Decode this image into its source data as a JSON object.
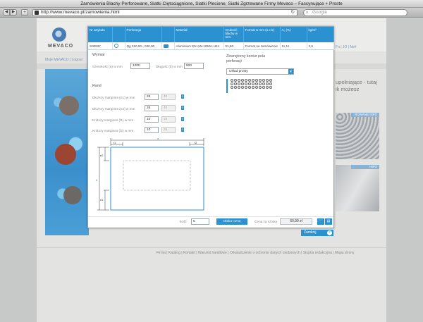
{
  "browser": {
    "window_title": "Zamówienia Blachy Perforowane, Siatki Cięto­ciągnione, Siatki Plecione, Siatki Zgrzewane Firmy Mevaco – Fascynujące + Proste",
    "url": "http://www.mevaco.pl/zamowienia.html",
    "search_placeholder": "Google",
    "back": "◀",
    "forward": "▶",
    "add": "+",
    "reload": "↻"
  },
  "background": {
    "logo": "MEVACO",
    "links": "Moje MEVACO | Logout",
    "topright": "Fn | JO | Ne#",
    "right_text_line1": "upełniające - tutaj",
    "right_text_line2": "ik możesz",
    "panel1_label": "ROWANE",
    "panel1_info": "INFO",
    "panel2_info": "INFO",
    "footer": "Firma | Katalog | Kontakt | Warunki handlowe | Oświadczenie o ochronie danych osobowych | Stopka redakcyjna | Mapa strony"
  },
  "modal": {
    "table": {
      "headers": [
        "Nr artykułu",
        "",
        "Perforacja",
        "",
        "Materiał",
        "Grubość blachy w mm",
        "Format w mm (a x b)",
        "A₀ (%)",
        "kg/m²"
      ],
      "row": [
        "S00937",
        "",
        "Qg 010,00 - 030,00",
        "",
        "Aluminium EN AW-1050A H24",
        "01,50",
        "Format na zamówienie",
        "11,11",
        "3,6"
      ]
    },
    "wymiar": {
      "title": "Wymiar",
      "width_label": "Szerokość (a) w mm",
      "width_value": "1200",
      "length_label": "Długość (b) w mm",
      "length_value": "800"
    },
    "kontur": {
      "title_line1": "Zewnętrzny kontur pola",
      "title_line2": "perforacji",
      "select_value": "Układ prosty"
    },
    "rand": {
      "title": "Rand",
      "rows": [
        {
          "label": "Dłuższy margines (e1) w mm",
          "value": "25",
          "alt": "40"
        },
        {
          "label": "Dłuższy margines (e2) w mm",
          "value": "25",
          "alt": "40"
        },
        {
          "label": "Krótszy margines (f1) w mm",
          "value": "10",
          "alt": "25"
        },
        {
          "label": "Krótszy margines (f2) w mm",
          "value": "10",
          "alt": "25"
        }
      ],
      "info": "i"
    },
    "drawing": {
      "label_a": "a",
      "label_f1": "f1",
      "label_f2": "f2",
      "label_e1": "e1",
      "label_e2": "e2",
      "label_b": "b"
    },
    "bottom": {
      "qty_label": "Ilość",
      "qty_value": "5",
      "calc_button": "Oblicz cenę",
      "price_label": "Cena za sztukę",
      "price_value": "60,99 zł",
      "cart_icon": "🛒",
      "doc_icon": "▤"
    },
    "close_label": "Zamknij",
    "close_icon": "×"
  }
}
